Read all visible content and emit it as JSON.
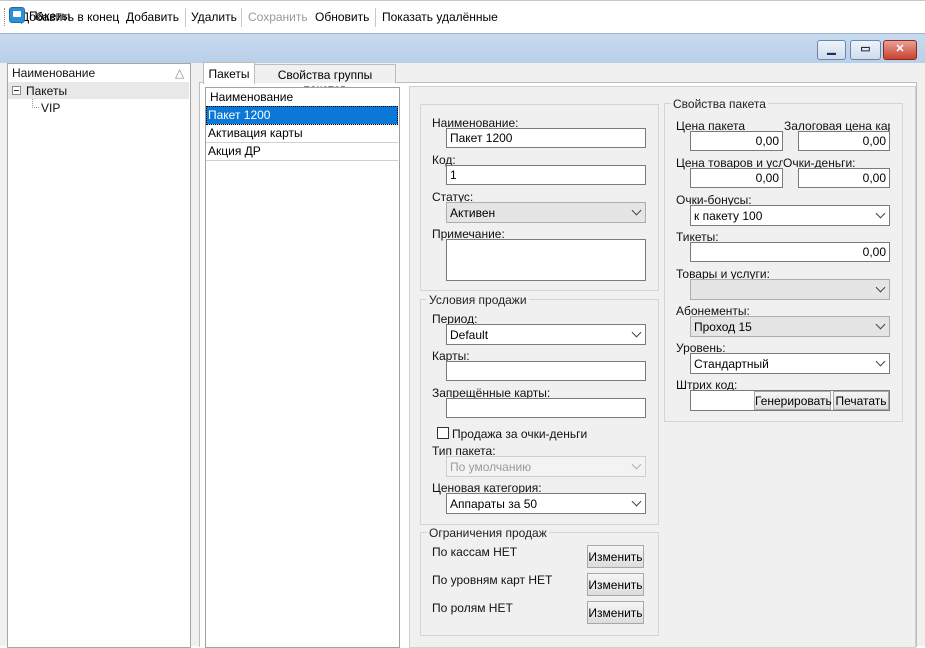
{
  "toolbar": {
    "add_to_end": "Добавить в конец",
    "add": "Добавить",
    "delete": "Удалить",
    "save": "Сохранить",
    "refresh": "Обновить",
    "show_deleted": "Показать удалённые"
  },
  "window": {
    "title": "Пакеты"
  },
  "tree": {
    "header": "Наименование",
    "sort_glyph": "△",
    "root": "Пакеты",
    "child": "VIP"
  },
  "tabs": [
    "Пакеты",
    "Свойства группы пакетов"
  ],
  "list": {
    "header": "Наименование",
    "items": [
      "Пакет 1200",
      "Активация карты",
      "Акция ДР"
    ]
  },
  "form": {
    "name_label": "Наименование:",
    "name_value": "Пакет 1200",
    "code_label": "Код:",
    "code_value": "1",
    "status_label": "Статус:",
    "status_value": "Активен",
    "note_label": "Примечание:",
    "note_value": ""
  },
  "sale_conditions": {
    "title": "Условия продажи",
    "period_label": "Период:",
    "period_value": "Default",
    "cards_label": "Карты:",
    "cards_value": "",
    "forbidden_label": "Запрещённые карты:",
    "forbidden_value": "",
    "points_checkbox": "Продажа за очки-деньги",
    "type_label": "Тип пакета:",
    "type_value": "По умолчанию",
    "price_cat_label": "Ценовая категория:",
    "price_cat_value": "Аппараты за 50"
  },
  "restrictions": {
    "title": "Ограничения продаж",
    "by_cash": "По кассам НЕТ",
    "by_levels": "По уровням карт НЕТ",
    "by_roles": "По ролям НЕТ",
    "change": "Изменить"
  },
  "props": {
    "title": "Свойства пакета",
    "price_label": "Цена пакета",
    "price_value": "0,00",
    "deposit_label": "Залоговая цена карт",
    "deposit_value": "0,00",
    "goods_price_label": "Цена товаров и услуг",
    "goods_price_value": "0,00",
    "points_money_label": "Очки-деньги:",
    "points_money_value": "0,00",
    "bonus_label": "Очки-бонусы:",
    "bonus_value": "к пакету 100",
    "tickets_label": "Тикеты:",
    "tickets_value": "0,00",
    "goods_label": "Товары и услуги:",
    "goods_value": "",
    "subs_label": "Абонементы:",
    "subs_value": "Проход 15",
    "level_label": "Уровень:",
    "level_value": "Стандартный",
    "barcode_label": "Штрих код:",
    "barcode_value": "",
    "generate": "Генерировать",
    "print": "Печатать"
  }
}
